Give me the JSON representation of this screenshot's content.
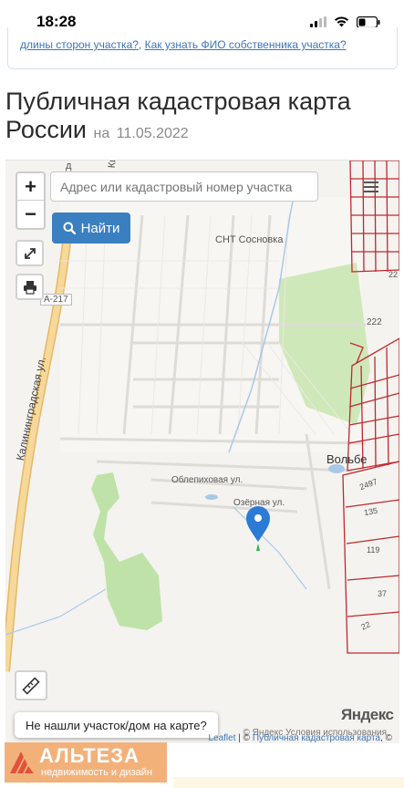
{
  "status_bar": {
    "time": "18:28"
  },
  "top_links": {
    "link_1": "длины сторон участка?",
    "separator": ",",
    "link_2": "Как узнать ФИО собственника участка?"
  },
  "page": {
    "title": "Публичная кадастровая карта России",
    "date_prefix": "на",
    "date": "11.05.2022"
  },
  "map": {
    "zoom_in_label": "+",
    "zoom_out_label": "−",
    "search": {
      "placeholder": "Адрес или кадастровый номер участка",
      "value": ""
    },
    "find_button": "Найти",
    "not_found_button": "Не нашли участок/дом на карте?",
    "attribution": {
      "leaflet": "Leaflet",
      "sep": "|",
      "copyright": "©",
      "link": "Публичная кадастровая карта",
      "tail": ", ©",
      "yandex_terms": "© Яндекс Условия использования"
    },
    "yandex_logo": "Яндекс",
    "labels": {
      "road_number": "А-217",
      "kaliningrad_street": "Калининградская ул.",
      "snt": "СНТ Сосновка",
      "oblepikhovaya": "Облепиховая ул.",
      "ozernaya": "Озёрная ул.",
      "village": "Вольбе",
      "partial_street": "Ки",
      "partial_street_2": "д"
    },
    "parcel_numbers": [
      "22",
      "222",
      "2497",
      "135",
      "119",
      "37",
      "22"
    ]
  },
  "brand": {
    "name": "АЛЬТЕЗА",
    "tagline": "недвижимость и дизайн"
  },
  "colors": {
    "accent_blue": "#3a7fc0",
    "link_blue": "#3d74b8",
    "cadastral_red": "#c0282e",
    "forest_green": "#bfe2a8",
    "marker_blue": "#2a7ad6",
    "brand_orange": "#f3b17a"
  }
}
